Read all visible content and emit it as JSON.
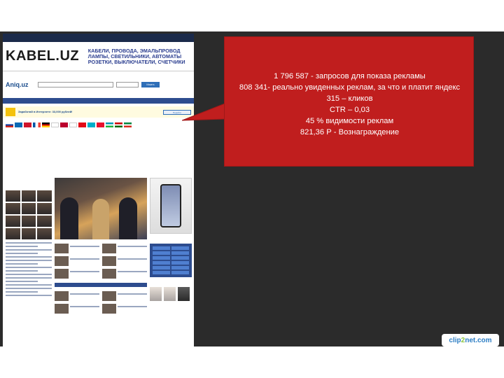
{
  "callout": {
    "lines": [
      "1 796 587 - запросов для показа рекламы",
      "808 341- реально увиденных реклам, за что и платит яндекс",
      "315 – кликов",
      "CTR – 0,03",
      "45 % видимости реклам",
      "821,36 Р - Вознаграждение"
    ]
  },
  "site": {
    "banner_logo": "KABEL.UZ",
    "banner_slogan": "КАБЕЛИ, ПРОВОДА, ЭМАЛЬПРОВОД ЛАМПЫ, СВЕТИЛЬНИКИ, АВТОМАТЫ РОЗЕТКИ, ВЫКЛЮЧАТЕЛИ, СЧЕТЧИКИ",
    "search_logo": "Aniq.uz",
    "search_button": "Искать",
    "ad_title": "Заработай в Интернете: 33,000 рублей!",
    "ad_button": "Перейти",
    "phone_ad_label": "Galaxy A10"
  },
  "watermark": {
    "part1": "clip",
    "part2": "2",
    "part3": "net.com"
  },
  "colors": {
    "callout": "#c01e1e",
    "dark_panel": "#2b2b2b",
    "site_accent": "#2d4c8e"
  }
}
